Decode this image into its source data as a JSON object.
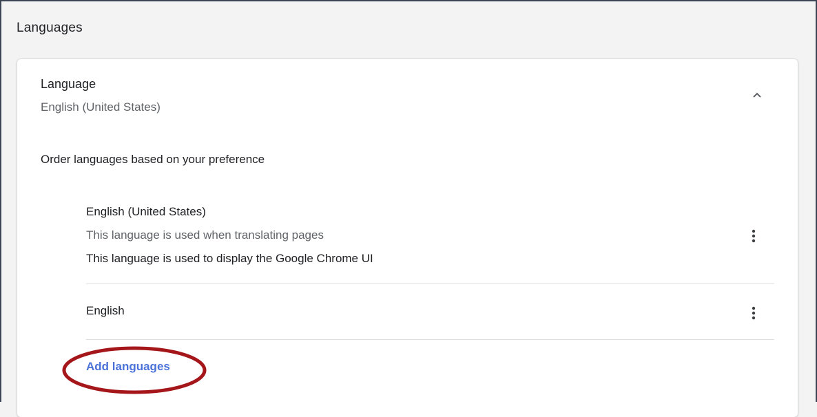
{
  "section": {
    "title": "Languages"
  },
  "language_panel": {
    "header_title": "Language",
    "current_language": "English (United States)",
    "collapse_icon": "chevron-up-icon",
    "order_label": "Order languages based on your preference",
    "languages": [
      {
        "name": "English (United States)",
        "notes": [
          "This language is used when translating pages",
          "This language is used to display the Google Chrome UI"
        ],
        "menu_icon": "more-vert-icon"
      },
      {
        "name": "English",
        "notes": [],
        "menu_icon": "more-vert-icon"
      }
    ],
    "add_languages_label": "Add languages"
  },
  "colors": {
    "link": "#4a72d8",
    "annotation": "#a4161a",
    "frame_border": "#3c4453",
    "background": "#f3f3f3"
  }
}
